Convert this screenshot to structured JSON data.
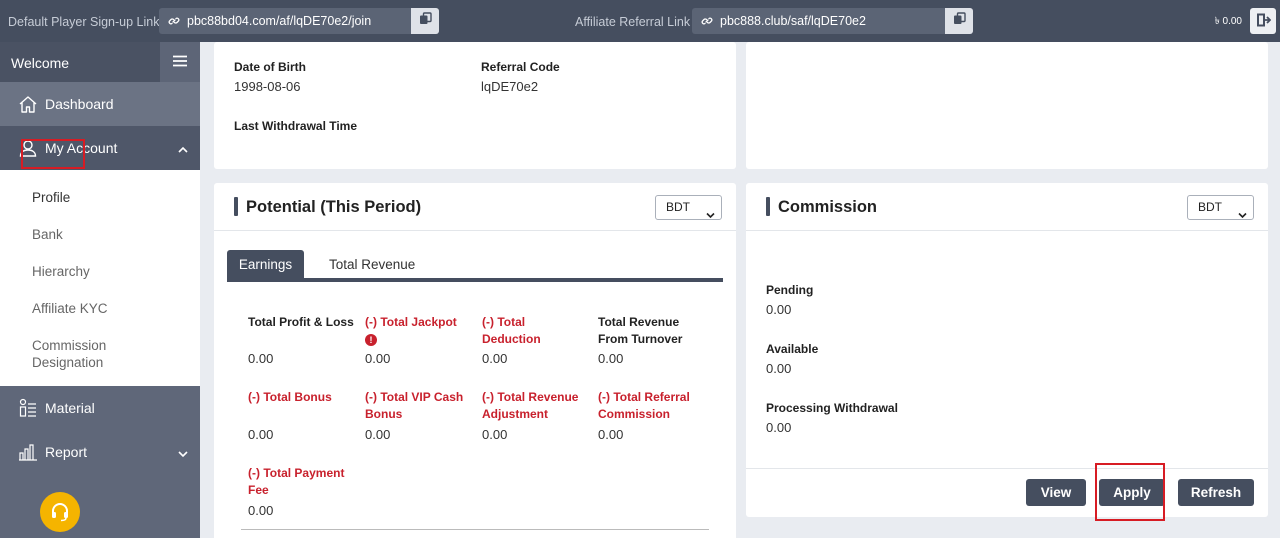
{
  "topbar": {
    "player_link_label": "Default Player Sign-up Link",
    "player_link_value": "pbc88bd04.com/af/lqDE70e2/join",
    "affiliate_link_label": "Affiliate Referral Link",
    "affiliate_link_value": "pbc888.club/saf/lqDE70e2",
    "balance": "৳ 0.00",
    "icons": {
      "link": "link-icon",
      "copy": "copy-icon",
      "logout": "logout-icon"
    }
  },
  "sidebar": {
    "welcome": "Welcome",
    "dashboard": "Dashboard",
    "my_account": "My Account",
    "submenu": [
      "Profile",
      "Bank",
      "Hierarchy",
      "Affiliate KYC",
      "Commission Designation"
    ],
    "material": "Material",
    "report": "Report"
  },
  "profile": {
    "dob_label": "Date of Birth",
    "dob_value": "1998-08-06",
    "referral_label": "Referral Code",
    "referral_value": "lqDE70e2",
    "last_withdrawal_label": "Last Withdrawal Time"
  },
  "potential": {
    "title": "Potential (This Period)",
    "currency": "BDT",
    "tabs": [
      "Earnings",
      "Total Revenue"
    ],
    "items": [
      {
        "label": "Total Profit & Loss",
        "value": "0.00",
        "red": false
      },
      {
        "label": "(-) Total Jackpot",
        "value": "0.00",
        "red": true
      },
      {
        "label": "(-) Total Deduction",
        "value": "0.00",
        "red": true
      },
      {
        "label": "Total Revenue From Turnover",
        "value": "0.00",
        "red": false
      },
      {
        "label": "(-) Total Bonus",
        "value": "0.00",
        "red": true
      },
      {
        "label": "(-) Total VIP Cash Bonus",
        "value": "0.00",
        "red": true
      },
      {
        "label": "(-) Total Revenue Adjustment",
        "value": "0.00",
        "red": true
      },
      {
        "label": "(-) Total Referral Commission",
        "value": "0.00",
        "red": true
      },
      {
        "label": "(-) Total Payment Fee",
        "value": "0.00",
        "red": true
      }
    ]
  },
  "commission": {
    "title": "Commission",
    "currency": "BDT",
    "pending_label": "Pending",
    "pending_value": "0.00",
    "available_label": "Available",
    "available_value": "0.00",
    "processing_label": "Processing Withdrawal",
    "processing_value": "0.00",
    "buttons": {
      "view": "View",
      "apply": "Apply",
      "refresh": "Refresh"
    }
  },
  "colors": {
    "topbar": "#454e5f",
    "sidebar": "#5f6779",
    "accent_red": "#c8212d",
    "highlight": "#d71c24",
    "support": "#f5b400"
  }
}
